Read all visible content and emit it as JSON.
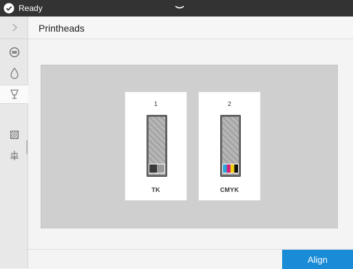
{
  "status_bar": {
    "status_text": "Ready",
    "status_icon": "check-circle-icon",
    "handle_icon": "chevron-down-icon"
  },
  "sidebar": {
    "items": [
      {
        "name": "expand",
        "icon": "chevron-right-icon"
      },
      {
        "name": "printer-status",
        "icon": "gauge-icon"
      },
      {
        "name": "ink",
        "icon": "ink-drop-icon"
      },
      {
        "name": "printheads",
        "icon": "printhead-icon",
        "active": true
      },
      {
        "name": "paper",
        "icon": "media-roll-icon"
      },
      {
        "name": "maintenance",
        "icon": "alignment-tool-icon"
      }
    ]
  },
  "page": {
    "title": "Printheads"
  },
  "printheads": [
    {
      "slot": "1",
      "name": "TK",
      "inks": [
        "#3a3a3a",
        "#9a9a9a"
      ]
    },
    {
      "slot": "2",
      "name": "CMYK",
      "inks": [
        "#2aa6d8",
        "#d4237e",
        "#f0d210",
        "#111111"
      ]
    }
  ],
  "footer": {
    "align_label": "Align"
  },
  "colors": {
    "accent": "#1a8bd6",
    "topbar": "#333333",
    "panel": "#cfcfcf"
  }
}
